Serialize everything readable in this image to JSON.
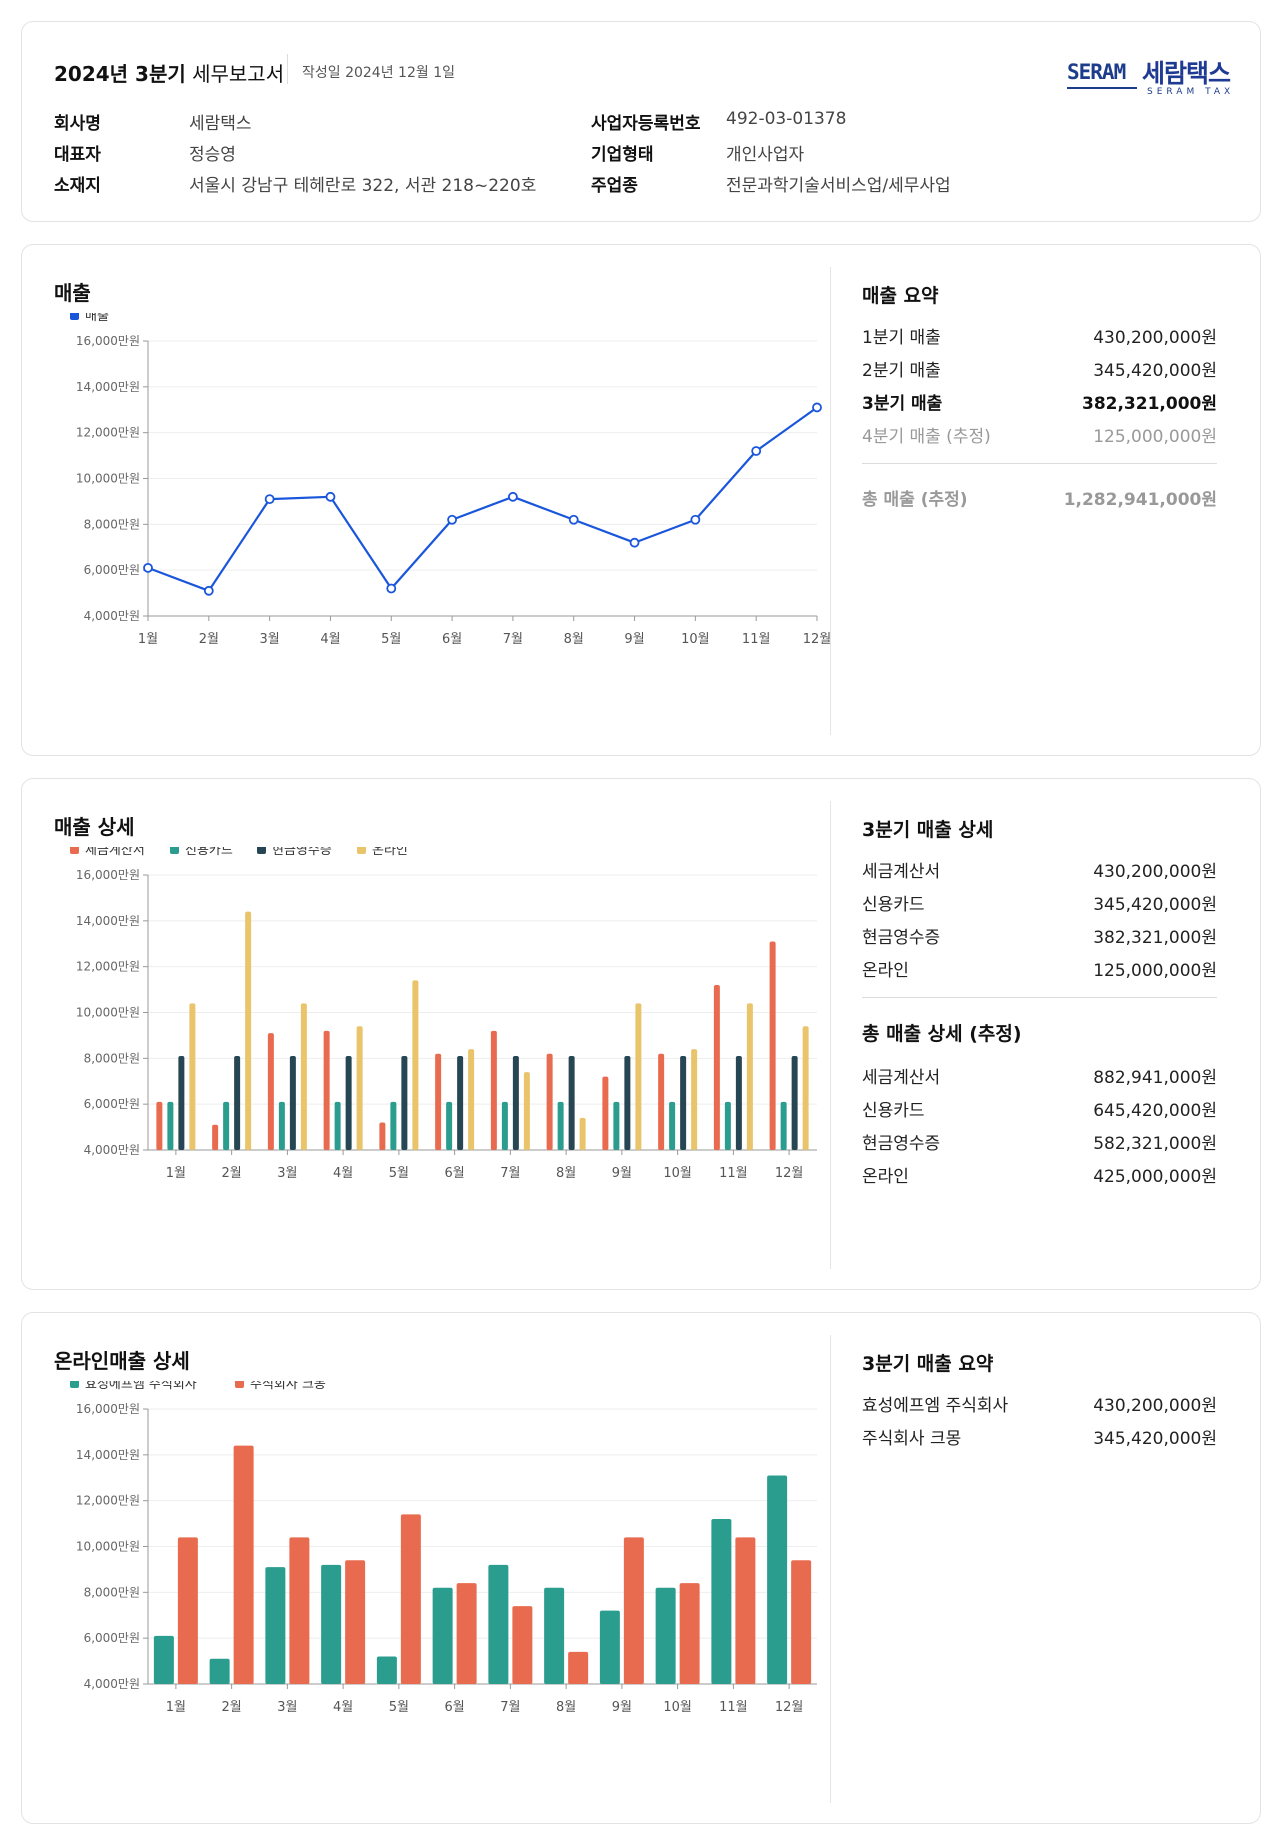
{
  "header": {
    "title_bold": "2024년 3분기",
    "title_rest": "세무보고서",
    "date": "작성일 2024년 12월 1일",
    "logo": {
      "en": "SERAM",
      "ko": "세람택스",
      "sub": "SERAM TAX"
    },
    "info": {
      "company_label": "회사명",
      "company_value": "세람택스",
      "ceo_label": "대표자",
      "ceo_value": "정승영",
      "address_label": "소재지",
      "address_value": "서울시 강남구 테헤란로 322, 서관 218~220호",
      "regno_label": "사업자등록번호",
      "regno_value": "492-03-01378",
      "type_label": "기업형태",
      "type_value": "개인사업자",
      "industry_label": "주업종",
      "industry_value": "전문과학기술서비스업/세무사업"
    }
  },
  "sales": {
    "title": "매출",
    "summary": {
      "title": "매출 요약",
      "rows": [
        {
          "label": "1분기 매출",
          "value": "430,200,000원"
        },
        {
          "label": "2분기 매출",
          "value": "345,420,000원"
        },
        {
          "label": "3분기 매출",
          "value": "382,321,000원"
        },
        {
          "label": "4분기 매출 (추정)",
          "value": "125,000,000원"
        }
      ],
      "total_label": "총 매출 (추정)",
      "total_value": "1,282,941,000원"
    }
  },
  "detail": {
    "title": "매출 상세",
    "summary": {
      "title": "3분기 매출 상세",
      "rows": [
        {
          "label": "세금계산서",
          "value": "430,200,000원"
        },
        {
          "label": "신용카드",
          "value": "345,420,000원"
        },
        {
          "label": "현금영수증",
          "value": "382,321,000원"
        },
        {
          "label": "온라인",
          "value": "125,000,000원"
        }
      ],
      "total_title": "총 매출 상세 (추정)",
      "total_rows": [
        {
          "label": "세금계산서",
          "value": "882,941,000원"
        },
        {
          "label": "신용카드",
          "value": "645,420,000원"
        },
        {
          "label": "현금영수증",
          "value": "582,321,000원"
        },
        {
          "label": "온라인",
          "value": "425,000,000원"
        }
      ]
    }
  },
  "online": {
    "title": "온라인매출 상세",
    "summary": {
      "title": "3분기 매출 요약",
      "rows": [
        {
          "label": "효성에프엠 주식회사",
          "value": "430,200,000원"
        },
        {
          "label": "주식회사 크몽",
          "value": "345,420,000원"
        }
      ]
    }
  },
  "chart_data": [
    {
      "type": "line",
      "categories": [
        "1월",
        "2월",
        "3월",
        "4월",
        "5월",
        "6월",
        "7월",
        "8월",
        "9월",
        "10월",
        "11월",
        "12월"
      ],
      "series": [
        {
          "name": "매출",
          "color": "#1a56db",
          "values": [
            6100,
            5100,
            9100,
            9200,
            5200,
            8200,
            9200,
            8200,
            7200,
            8200,
            11200,
            13100
          ]
        }
      ],
      "yticks": [
        "4,000만원",
        "6,000만원",
        "8,000만원",
        "10,000만원",
        "12,000만원",
        "14,000만원",
        "16,000만원"
      ],
      "ylim": [
        4000,
        16000
      ],
      "grid": true,
      "legend": "top-left"
    },
    {
      "type": "bar",
      "categories": [
        "1월",
        "2월",
        "3월",
        "4월",
        "5월",
        "6월",
        "7월",
        "8월",
        "9월",
        "10월",
        "11월",
        "12월"
      ],
      "series": [
        {
          "name": "세금계산서",
          "color": "#e96b4f",
          "values": [
            6100,
            5100,
            9100,
            9200,
            5200,
            8200,
            9200,
            8200,
            7200,
            8200,
            11200,
            13100
          ]
        },
        {
          "name": "신용카드",
          "color": "#2a9d8f",
          "values": [
            6100,
            6100,
            6100,
            6100,
            6100,
            6100,
            6100,
            6100,
            6100,
            6100,
            6100,
            6100
          ]
        },
        {
          "name": "현금영수증",
          "color": "#264653",
          "values": [
            8100,
            8100,
            8100,
            8100,
            8100,
            8100,
            8100,
            8100,
            8100,
            8100,
            8100,
            8100
          ]
        },
        {
          "name": "온라인",
          "color": "#e9c46a",
          "values": [
            10400,
            14400,
            10400,
            9400,
            11400,
            8400,
            7400,
            5400,
            10400,
            8400,
            10400,
            9400
          ]
        }
      ],
      "yticks": [
        "4,000만원",
        "6,000만원",
        "8,000만원",
        "10,000만원",
        "12,000만원",
        "14,000만원",
        "16,000만원"
      ],
      "ylim": [
        4000,
        16000
      ],
      "grid": true,
      "legend": "top-left"
    },
    {
      "type": "bar",
      "categories": [
        "1월",
        "2월",
        "3월",
        "4월",
        "5월",
        "6월",
        "7월",
        "8월",
        "9월",
        "10월",
        "11월",
        "12월"
      ],
      "series": [
        {
          "name": "효성에프엠 주식회사",
          "color": "#2a9d8f",
          "values": [
            6100,
            5100,
            9100,
            9200,
            5200,
            8200,
            9200,
            8200,
            7200,
            8200,
            11200,
            13100
          ]
        },
        {
          "name": "주식회사 크몽",
          "color": "#e96b4f",
          "values": [
            10400,
            14400,
            10400,
            9400,
            11400,
            8400,
            7400,
            5400,
            10400,
            8400,
            10400,
            9400
          ]
        }
      ],
      "yticks": [
        "4,000만원",
        "6,000만원",
        "8,000만원",
        "10,000만원",
        "12,000만원",
        "14,000만원",
        "16,000만원"
      ],
      "ylim": [
        4000,
        16000
      ],
      "grid": true,
      "legend": "top-left"
    }
  ]
}
